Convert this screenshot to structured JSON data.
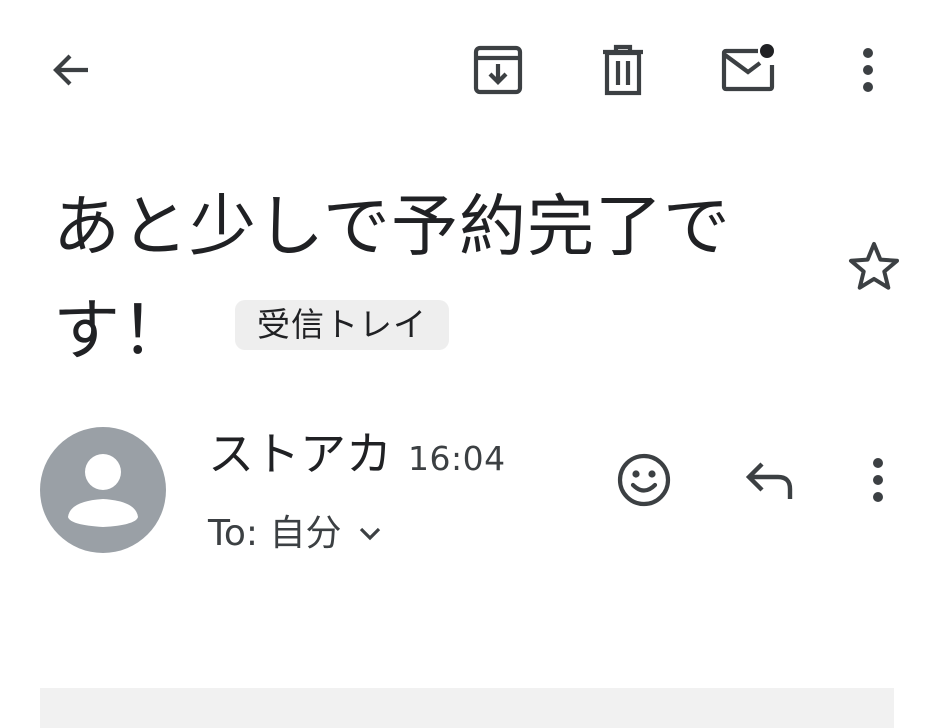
{
  "toolbar": {
    "back_icon": "arrow-back-icon",
    "archive_icon": "archive-icon",
    "delete_icon": "trash-icon",
    "mark_unread_icon": "mail-unread-icon",
    "more_icon": "more-vert-icon"
  },
  "email": {
    "subject": "あと少しで予約完了です！",
    "label": "受信トレイ",
    "star_icon": "star-outline-icon"
  },
  "sender": {
    "name": "ストアカ",
    "time": "16:04",
    "recipient": "To: 自分",
    "avatar_icon": "person-avatar-icon",
    "reaction_icon": "emoji-icon",
    "reply_icon": "reply-icon",
    "more_icon": "more-vert-icon"
  },
  "colors": {
    "text": "#202124",
    "icon": "#3c4043",
    "avatar_bg": "#9aa0a6",
    "chip_bg": "#eeeeee"
  }
}
